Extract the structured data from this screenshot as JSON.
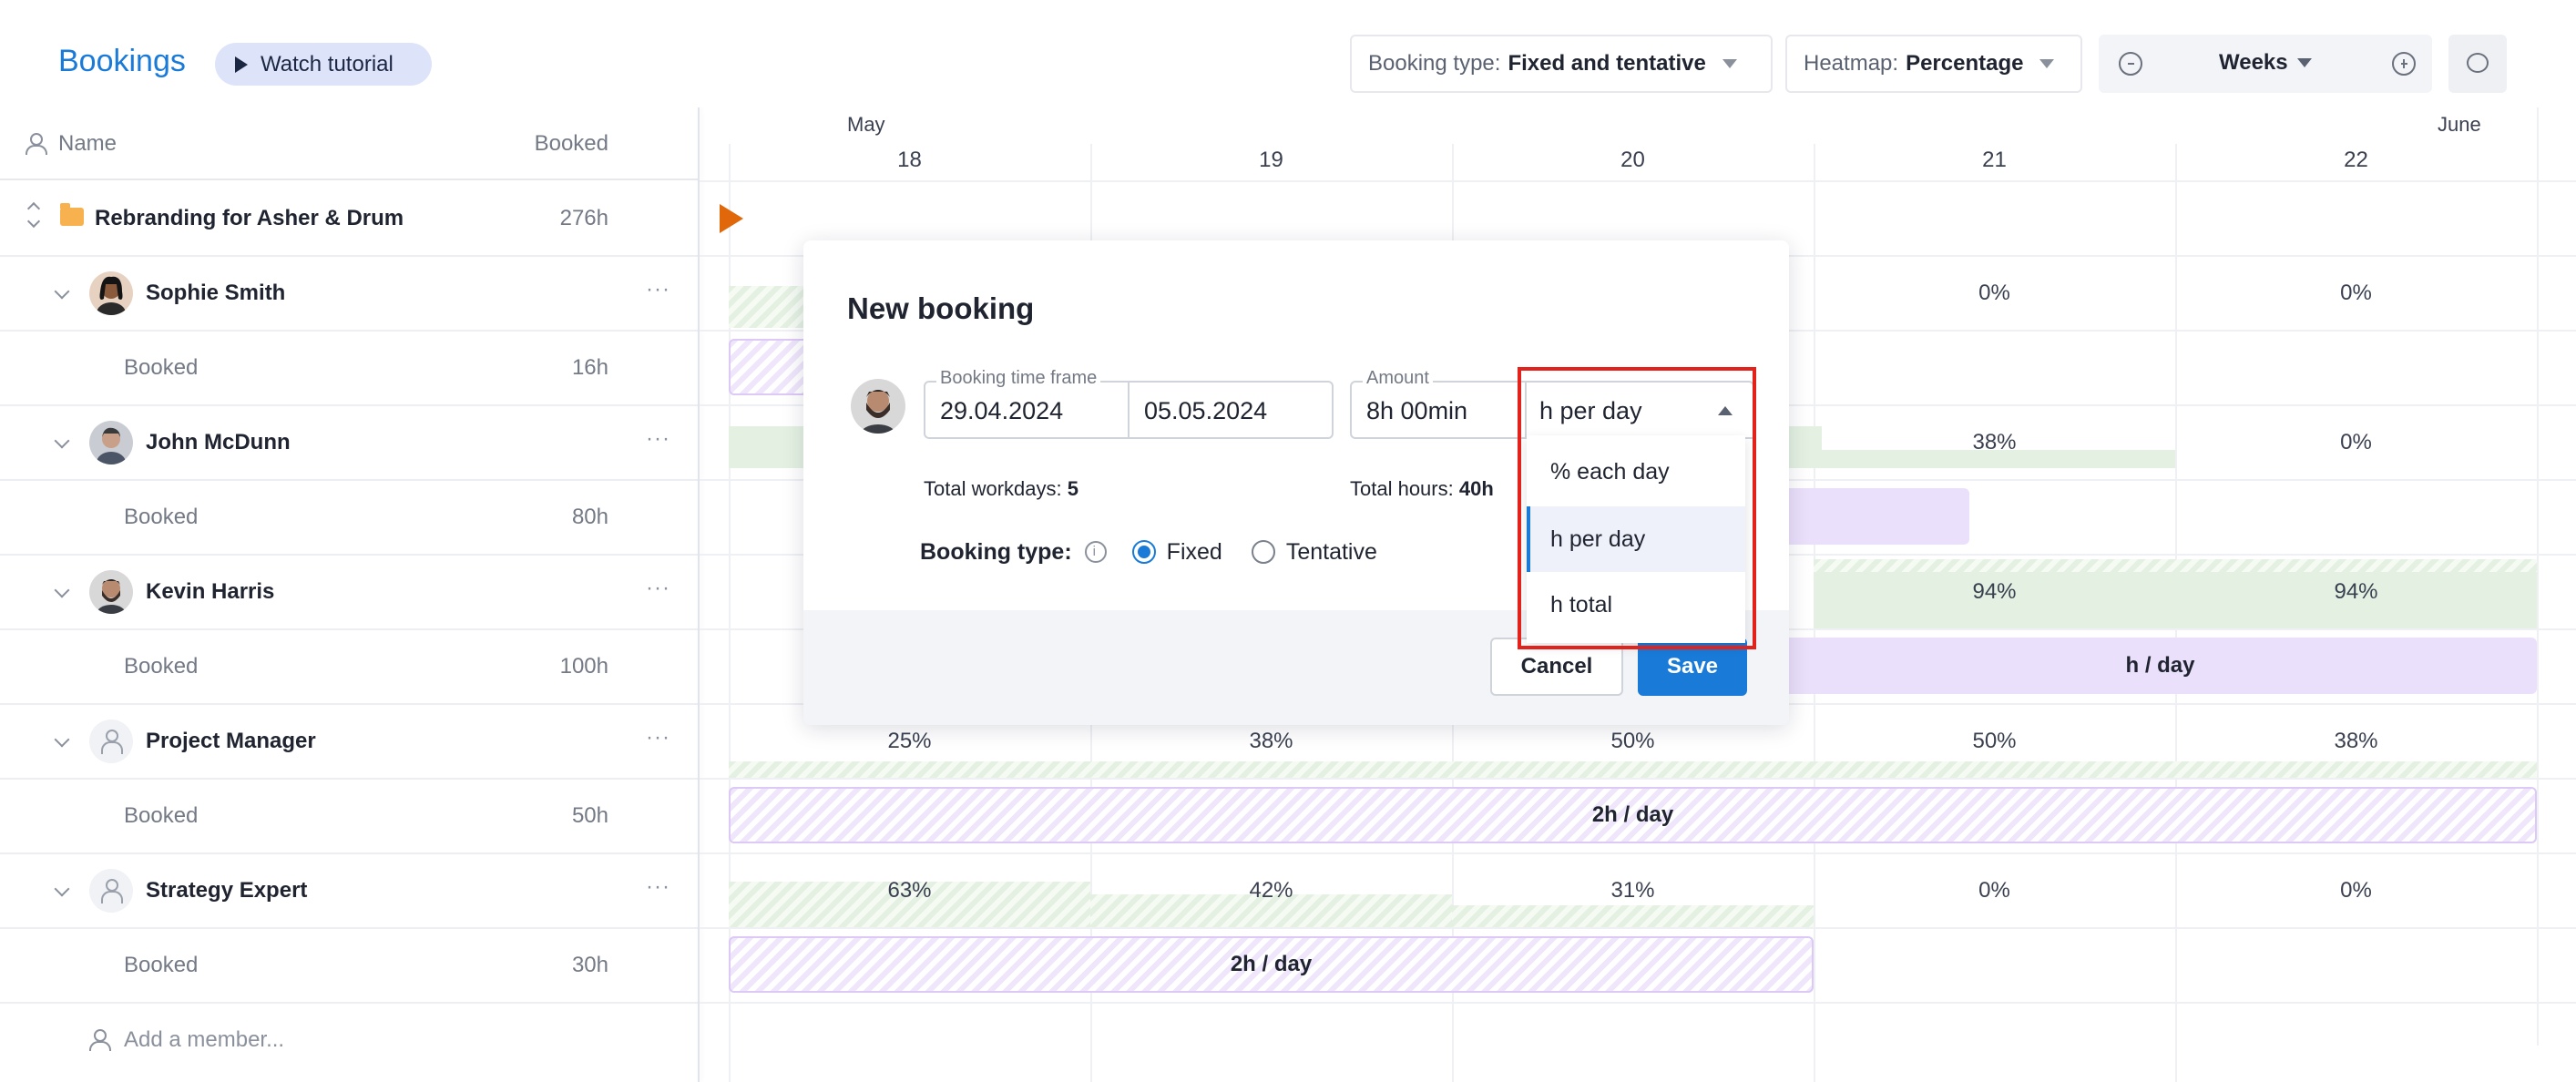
{
  "header": {
    "title": "Bookings",
    "tutorial_label": "Watch tutorial",
    "booking_type_label": "Booking type:",
    "booking_type_value": "Fixed and tentative",
    "heatmap_label": "Heatmap:",
    "heatmap_value": "Percentage",
    "view_value": "Weeks"
  },
  "columns": {
    "name": "Name",
    "booked": "Booked"
  },
  "project": {
    "name": "Rebranding for Asher & Drum",
    "hours": "276h"
  },
  "members": [
    {
      "name": "Sophie Smith",
      "booked_label": "Booked",
      "booked_hours": "16h"
    },
    {
      "name": "John McDunn",
      "booked_label": "Booked",
      "booked_hours": "80h"
    },
    {
      "name": "Kevin Harris",
      "booked_label": "Booked",
      "booked_hours": "100h"
    },
    {
      "name": "Project Manager",
      "booked_label": "Booked",
      "booked_hours": "50h"
    },
    {
      "name": "Strategy Expert",
      "booked_label": "Booked",
      "booked_hours": "30h"
    }
  ],
  "add_member": "Add a member...",
  "calendar": {
    "months": [
      "May",
      "June"
    ],
    "days": [
      "18",
      "19",
      "20",
      "21",
      "22"
    ],
    "sophie_pct": [
      "0%",
      "0%"
    ],
    "john_pct": [
      "38%",
      "0%"
    ],
    "kevin_pct": [
      "94%",
      "94%"
    ],
    "kevin_bar": "h / day",
    "pm_pct": [
      "25%",
      "38%",
      "50%",
      "50%",
      "38%"
    ],
    "pm_bar": "2h / day",
    "se_pct": [
      "63%",
      "42%",
      "31%",
      "0%",
      "0%"
    ],
    "se_bar": "2h / day"
  },
  "modal": {
    "title": "New booking",
    "timeframe_legend": "Booking time frame",
    "start_date": "29.04.2024",
    "end_date": "05.05.2024",
    "amount_legend": "Amount",
    "amount_value": "8h 00min",
    "unit_value": "h per day",
    "workdays_label": "Total workdays:",
    "workdays_value": "5",
    "hours_label": "Total hours:",
    "hours_value": "40h",
    "booking_type_label": "Booking type:",
    "option_fixed": "Fixed",
    "option_tentative": "Tentative",
    "cancel": "Cancel",
    "save": "Save"
  },
  "dropdown": {
    "options": [
      "% each day",
      "h per day",
      "h total"
    ],
    "selected": "h per day"
  },
  "colors": {
    "accent": "#1a7ad8",
    "highlight": "#e3231b",
    "heat_green": "#e4f1e2",
    "booking_purple": "#ebe0fb"
  }
}
